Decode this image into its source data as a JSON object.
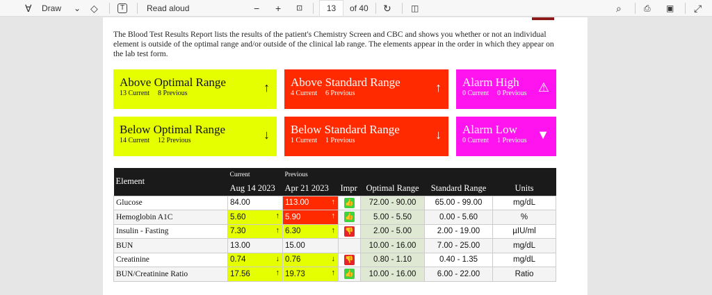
{
  "toolbar": {
    "draw": "Draw",
    "read_aloud": "Read aloud",
    "page": "13",
    "of_pages": "of 40"
  },
  "intro": "The Blood Test Results Report lists the results of the patient's Chemistry Screen and CBC and shows you whether or not an individual element is outside of the optimal range and/or outside of the clinical lab range. The elements appear in the order in which they appear on the lab test form.",
  "cards": [
    {
      "title": "Above Optimal Range",
      "current": "13 Current",
      "previous": "8 Previous",
      "icon": "↑"
    },
    {
      "title": "Above Standard Range",
      "current": "4 Current",
      "previous": "6 Previous",
      "icon": "↑"
    },
    {
      "title": "Alarm High",
      "current": "0 Current",
      "previous": "0 Previous",
      "icon": "⚠"
    },
    {
      "title": "Below Optimal Range",
      "current": "14 Current",
      "previous": "12 Previous",
      "icon": "↓"
    },
    {
      "title": "Below Standard Range",
      "current": "1 Current",
      "previous": "1 Previous",
      "icon": "↓"
    },
    {
      "title": "Alarm Low",
      "current": "0 Current",
      "previous": "1 Previous",
      "icon": "▼"
    }
  ],
  "table": {
    "headers": {
      "element": "Element",
      "current": "Current",
      "current_date": "Aug 14 2023",
      "previous": "Previous",
      "previous_date": "Apr 21 2023",
      "impr": "Impr",
      "optimal": "Optimal Range",
      "standard": "Standard Range",
      "units": "Units"
    },
    "rows": [
      {
        "element": "Glucose",
        "current": "84.00",
        "cur_flag": "",
        "cur_arrow": "",
        "previous": "113.00",
        "prev_flag": "red",
        "prev_arrow": "↑",
        "impr": "up",
        "optimal": "72.00 - 90.00",
        "standard": "65.00 - 99.00",
        "units": "mg/dL"
      },
      {
        "element": "Hemoglobin A1C",
        "current": "5.60",
        "cur_flag": "yellow",
        "cur_arrow": "↑",
        "previous": "5.90",
        "prev_flag": "red",
        "prev_arrow": "↑",
        "impr": "up",
        "optimal": "5.00 - 5.50",
        "standard": "0.00 - 5.60",
        "units": "%"
      },
      {
        "element": "Insulin - Fasting",
        "current": "7.30",
        "cur_flag": "yellow",
        "cur_arrow": "↑",
        "previous": "6.30",
        "prev_flag": "yellow",
        "prev_arrow": "↑",
        "impr": "down",
        "optimal": "2.00 - 5.00",
        "standard": "2.00 - 19.00",
        "units": "µIU/ml"
      },
      {
        "element": "BUN",
        "current": "13.00",
        "cur_flag": "",
        "cur_arrow": "",
        "previous": "15.00",
        "prev_flag": "",
        "prev_arrow": "",
        "impr": "",
        "optimal": "10.00 - 16.00",
        "standard": "7.00 - 25.00",
        "units": "mg/dL"
      },
      {
        "element": "Creatinine",
        "current": "0.74",
        "cur_flag": "yellow",
        "cur_arrow": "↓",
        "previous": "0.76",
        "prev_flag": "yellow",
        "prev_arrow": "↓",
        "impr": "down",
        "optimal": "0.80 - 1.10",
        "standard": "0.40 - 1.35",
        "units": "mg/dL"
      },
      {
        "element": "BUN/Creatinine Ratio",
        "current": "17.56",
        "cur_flag": "yellow",
        "cur_arrow": "↑",
        "previous": "19.73",
        "prev_flag": "yellow",
        "prev_arrow": "↑",
        "impr": "up",
        "optimal": "10.00 - 16.00",
        "standard": "6.00 - 22.00",
        "units": "Ratio"
      }
    ]
  }
}
